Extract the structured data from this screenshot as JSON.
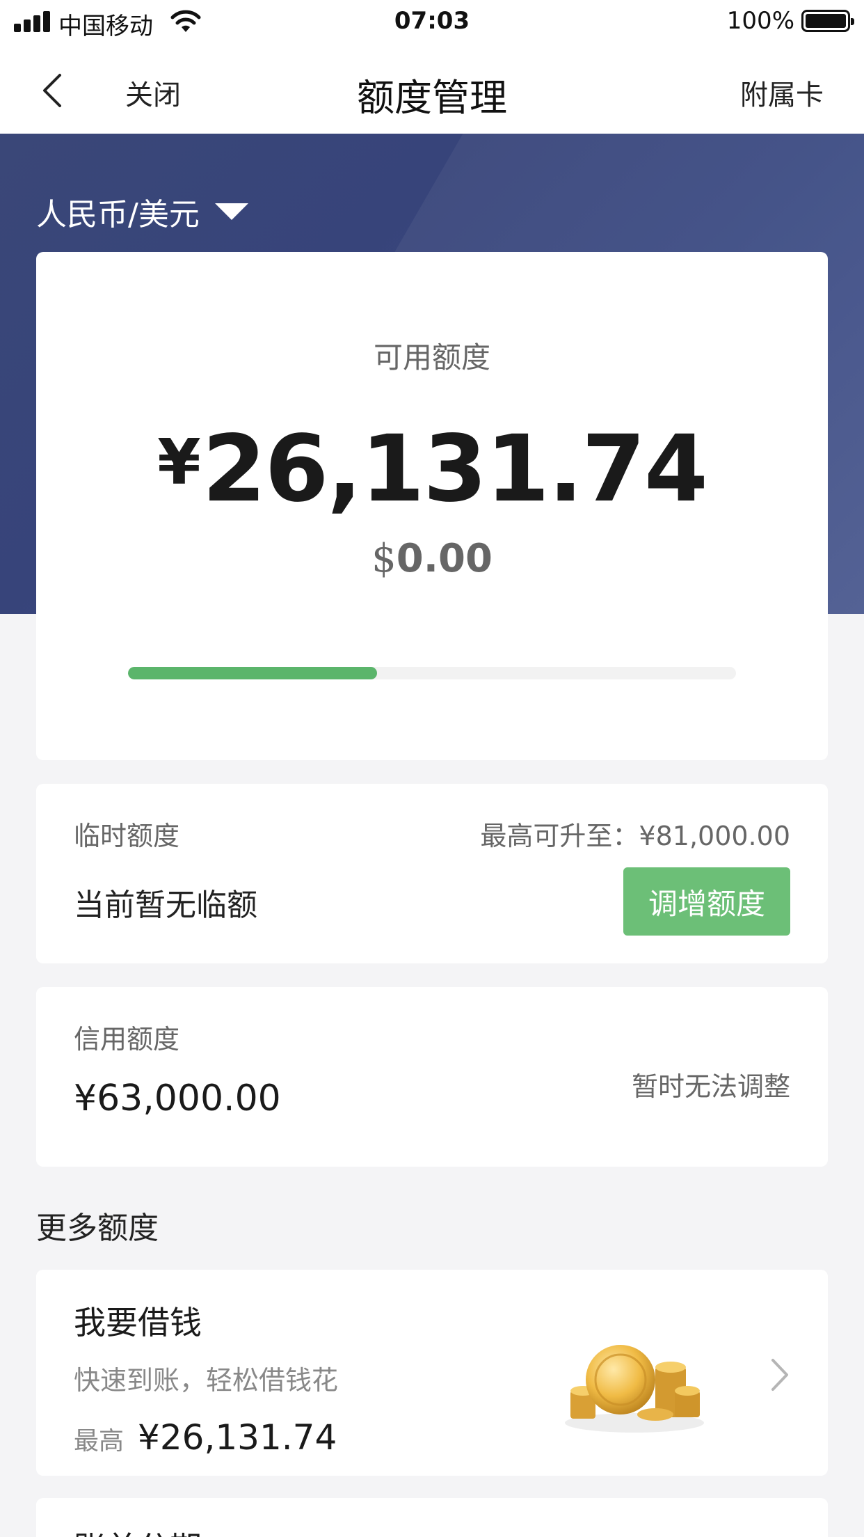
{
  "status_bar": {
    "carrier": "中国移动",
    "time": "07:03",
    "battery": "100%"
  },
  "nav": {
    "close_label": "关闭",
    "title": "额度管理",
    "right_label": "附属卡"
  },
  "currency_selector": {
    "label": "人民币/美元"
  },
  "available": {
    "label": "可用额度",
    "currency_symbol": "¥",
    "amount": "26,131.74",
    "usd_symbol": "$",
    "usd_amount": "0.00",
    "usage_fraction": 0.41
  },
  "temporary": {
    "label": "临时额度",
    "max_text": "最高可升至：¥81,000.00",
    "status": "当前暂无临额",
    "button_label": "调增额度"
  },
  "credit": {
    "label": "信用额度",
    "amount": "¥63,000.00",
    "note": "暂时无法调整"
  },
  "more": {
    "section_title": "更多额度"
  },
  "loan": {
    "title": "我要借钱",
    "subtitle": "快速到账，轻松借钱花",
    "max_label": "最高",
    "max_value": "¥26,131.74"
  },
  "next_item": {
    "title": "账单分期"
  },
  "colors": {
    "hero": "#3a4778",
    "accent_green": "#6cbf77",
    "progress_green": "#5bb56b"
  }
}
